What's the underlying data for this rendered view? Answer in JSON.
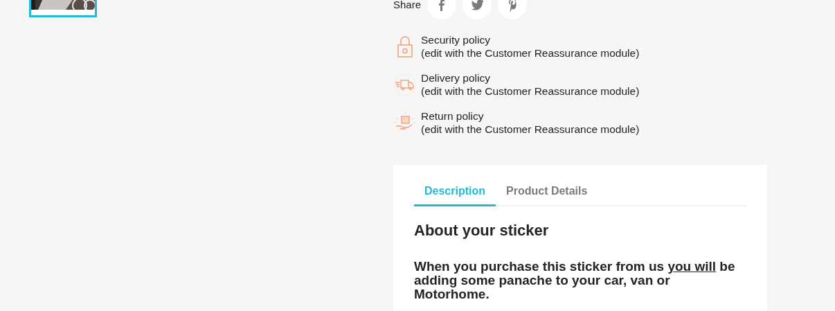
{
  "thumbnail": {
    "selected": true
  },
  "share": {
    "label": "Share",
    "networks": [
      {
        "kind": "facebook"
      },
      {
        "kind": "twitter"
      },
      {
        "kind": "pinterest"
      }
    ]
  },
  "policies": [
    {
      "kind": "security",
      "title": "Security policy",
      "note": "(edit with the Customer Reassurance module)"
    },
    {
      "kind": "delivery",
      "title": "Delivery policy",
      "note": "(edit with the Customer Reassurance module)"
    },
    {
      "kind": "return",
      "title": "Return policy",
      "note": "(edit with the Customer Reassurance module)"
    }
  ],
  "tabs": [
    {
      "label": "Description",
      "selected": true
    },
    {
      "label": "Product Details",
      "selected": false
    }
  ],
  "description": {
    "heading": "About your sticker",
    "subheading": {
      "before": "When you purchase this sticker from us ",
      "underlined": "you will",
      "after": " be adding some panache to your car, van or Motorhome."
    }
  }
}
